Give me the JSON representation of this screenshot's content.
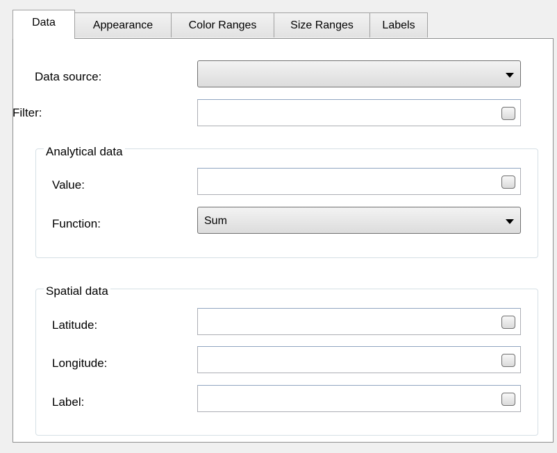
{
  "tabs": [
    {
      "label": "Data",
      "active": true
    },
    {
      "label": "Appearance",
      "active": false
    },
    {
      "label": "Color Ranges",
      "active": false
    },
    {
      "label": "Size Ranges",
      "active": false
    },
    {
      "label": "Labels",
      "active": false
    }
  ],
  "data_source": {
    "label": "Data source:",
    "value": ""
  },
  "filter": {
    "label": "Filter:",
    "value": ""
  },
  "analytical": {
    "title": "Analytical data",
    "value": {
      "label": "Value:",
      "value": ""
    },
    "function": {
      "label": "Function:",
      "value": "Sum"
    }
  },
  "spatial": {
    "title": "Spatial data",
    "latitude": {
      "label": "Latitude:",
      "value": ""
    },
    "longitude": {
      "label": "Longitude:",
      "value": ""
    },
    "label": {
      "label": "Label:",
      "value": ""
    }
  },
  "icons": {
    "dropdown": "chevron-down-icon",
    "ellipsis": "ellipsis-button"
  },
  "colors": {
    "panel_border": "#8e8f8f",
    "field_border": "#abadb3",
    "group_border": "#d5dfe5"
  }
}
